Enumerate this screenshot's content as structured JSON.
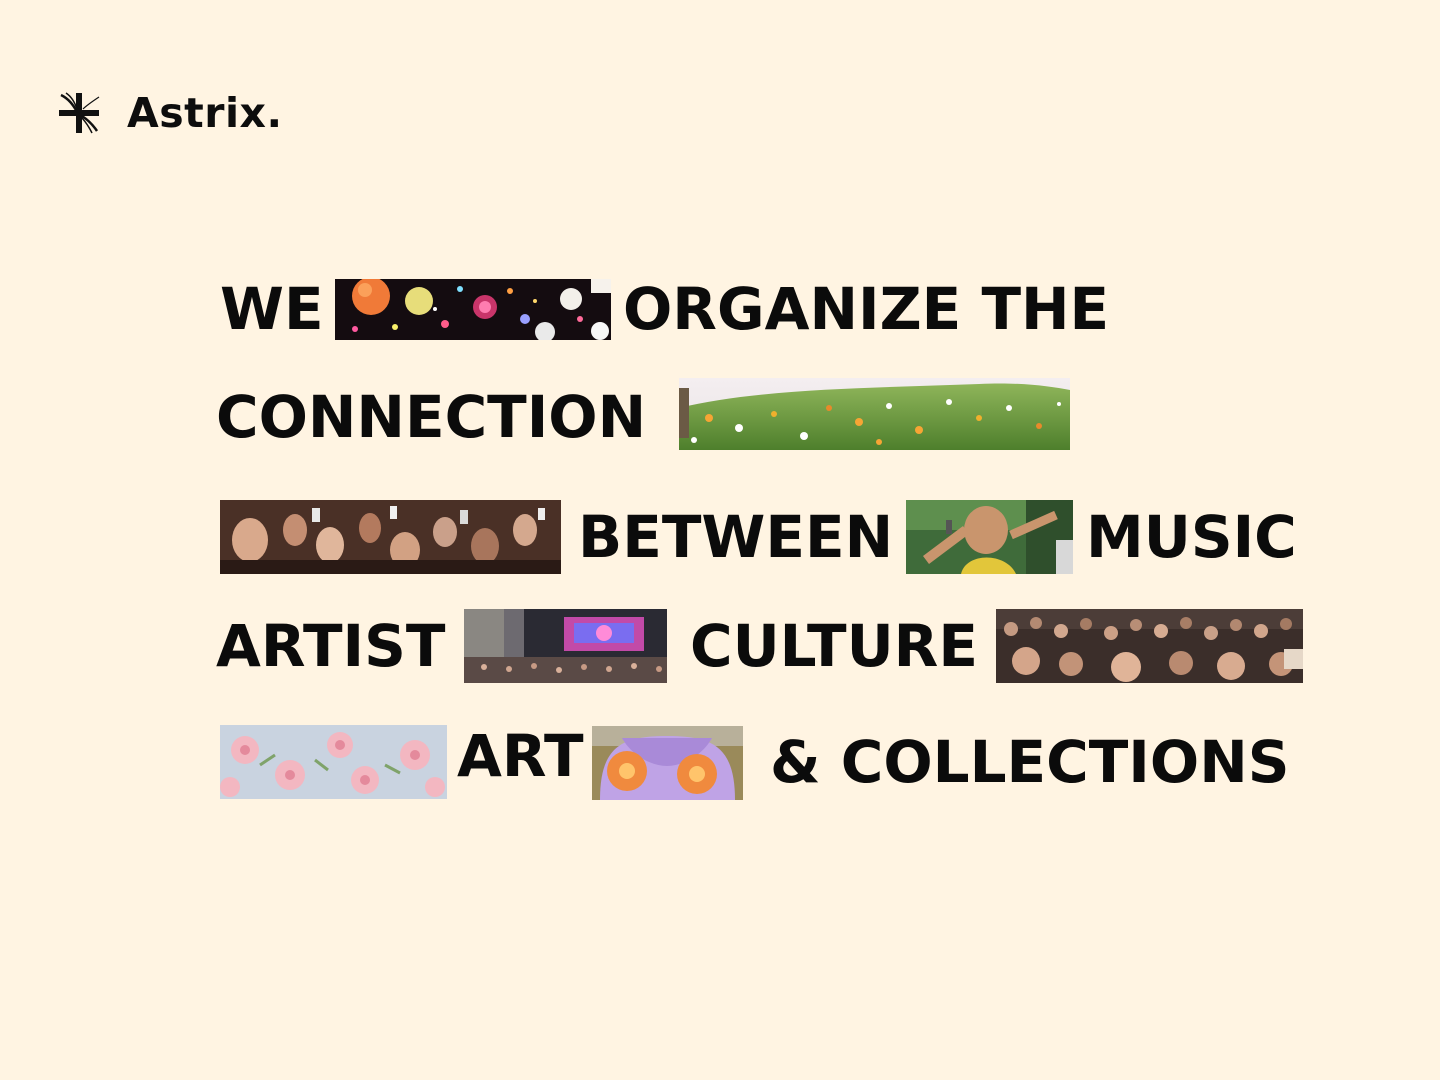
{
  "brand": {
    "name": "Astrix.",
    "logo_icon": "pinwheel-cross-icon"
  },
  "headline": {
    "words": {
      "we": "WE",
      "organize_the": "ORGANIZE THE",
      "connection": "CONNECTION",
      "between": "BETWEEN",
      "music": "MUSIC",
      "artist": "ARTIST",
      "culture": "CULTURE",
      "art": "ART",
      "collections": "& COLLECTIONS"
    },
    "images": [
      "party-confetti-balloons-photo",
      "flower-meadow-hill-photo",
      "concert-crowd-phones-photo",
      "singer-performing-outdoor-photo",
      "festival-stage-crowd-photo",
      "dense-festival-crowd-photo",
      "pink-flower-wall-photo",
      "purple-inflatable-sculpture-photo"
    ]
  },
  "colors": {
    "background": "#fff4e2",
    "text": "#0b0b0b"
  }
}
